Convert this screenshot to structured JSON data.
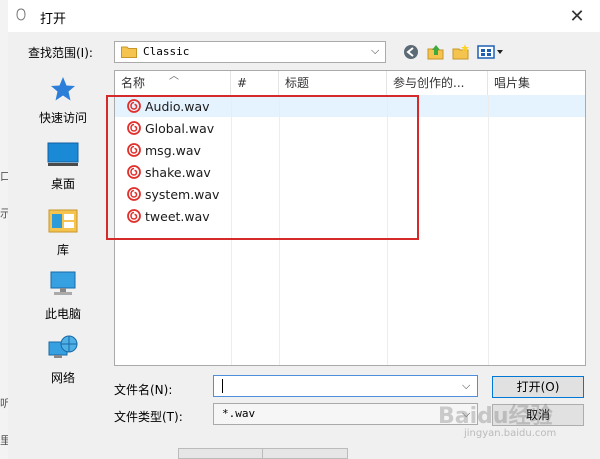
{
  "dialog": {
    "title": "打开",
    "close_glyph": "✕"
  },
  "background_chars": [
    "口",
    "示",
    "听",
    "里"
  ],
  "lookin": {
    "label": "查找范围(I):",
    "value": "Classic"
  },
  "places": [
    {
      "label": "快速访问",
      "icon": "star-icon"
    },
    {
      "label": "桌面",
      "icon": "desktop-icon"
    },
    {
      "label": "库",
      "icon": "library-icon"
    },
    {
      "label": "此电脑",
      "icon": "computer-icon"
    },
    {
      "label": "网络",
      "icon": "network-icon"
    }
  ],
  "columns": [
    "名称",
    "#",
    "标题",
    "参与创作的...",
    "唱片集"
  ],
  "files": [
    "Audio.wav",
    "Global.wav",
    "msg.wav",
    "shake.wav",
    "system.wav",
    "tweet.wav"
  ],
  "filename": {
    "label": "文件名(N):",
    "value": ""
  },
  "filetype": {
    "label": "文件类型(T):",
    "value": "*.wav"
  },
  "buttons": {
    "open": "打开(O)",
    "cancel": "取消"
  },
  "watermark": {
    "main": "Baidu经验",
    "sub": "jingyan.baidu.com"
  },
  "colors": {
    "highlight_box": "#d42a2a",
    "selected_row": "#e5f3ff",
    "file_icon": "#e0302b"
  }
}
